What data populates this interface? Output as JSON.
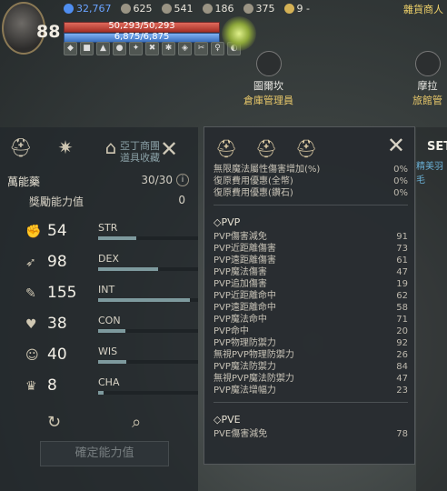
{
  "hud": {
    "level": "88",
    "currency_blue": "32,767",
    "stat1": "625",
    "stat2": "541",
    "stat3": "186",
    "stat4": "375",
    "stat5": "9 -",
    "hp": "50,293/50,293",
    "mp": "6,875/6,875",
    "hp_fraction": 1.0,
    "mp_fraction": 1.0,
    "top_right_npc": "雜貨商人",
    "buffs": [
      "◆",
      "■",
      "▲",
      "●",
      "✦",
      "✖",
      "✱",
      "◈",
      "✂",
      "♀",
      "◐"
    ]
  },
  "npcs": [
    {
      "name": "圖爾坎",
      "role": "倉庫管理員"
    },
    {
      "name": "摩拉",
      "role": "旅館管"
    }
  ],
  "left_panel": {
    "dim_label": "亞丁商團\n道具收藏",
    "elixir_label": "萬能藥",
    "elixir_value": "30/30",
    "bonus_label": "獎勵能力值",
    "bonus_value": "0",
    "attributes": [
      {
        "value": "54",
        "name": "STR",
        "fraction": 0.38
      },
      {
        "value": "98",
        "name": "DEX",
        "fraction": 0.6
      },
      {
        "value": "155",
        "name": "INT",
        "fraction": 0.92
      },
      {
        "value": "38",
        "name": "CON",
        "fraction": 0.27
      },
      {
        "value": "40",
        "name": "WIS",
        "fraction": 0.28
      },
      {
        "value": "8",
        "name": "CHA",
        "fraction": 0.05
      }
    ],
    "confirm_label": "確定能力值"
  },
  "tooltip": {
    "top_rows": [
      {
        "label": "無限魔法屬性傷害增加(%)",
        "value": "0%"
      },
      {
        "label": "復原費用優惠(全幣)",
        "value": "0%"
      },
      {
        "label": "復原費用優惠(鑽石)",
        "value": "0%"
      }
    ],
    "pvp_title": "◇PVP",
    "pvp_rows": [
      {
        "label": "PVP傷害減免",
        "value": "91"
      },
      {
        "label": "PVP近距離傷害",
        "value": "73"
      },
      {
        "label": "PVP遠距離傷害",
        "value": "61"
      },
      {
        "label": "PVP魔法傷害",
        "value": "47"
      },
      {
        "label": "PVP追加傷害",
        "value": "19"
      },
      {
        "label": "PVP近距離命中",
        "value": "62"
      },
      {
        "label": "PVP遠距離命中",
        "value": "58"
      },
      {
        "label": "PVP魔法命中",
        "value": "71"
      },
      {
        "label": "PVP命中",
        "value": "20"
      },
      {
        "label": "PVP物理防禦力",
        "value": "92"
      },
      {
        "label": "無視PVP物理防禦力",
        "value": "26"
      },
      {
        "label": "PVP魔法防禦力",
        "value": "84"
      },
      {
        "label": "無視PVP魔法防禦力",
        "value": "47"
      },
      {
        "label": "PVP魔法增幅力",
        "value": "23"
      }
    ],
    "pve_title": "◇PVE",
    "pve_rows": [
      {
        "label": "PVE傷害減免",
        "value": "78"
      }
    ]
  },
  "right_edge": {
    "set": "SET",
    "sub": "精美羽毛"
  }
}
